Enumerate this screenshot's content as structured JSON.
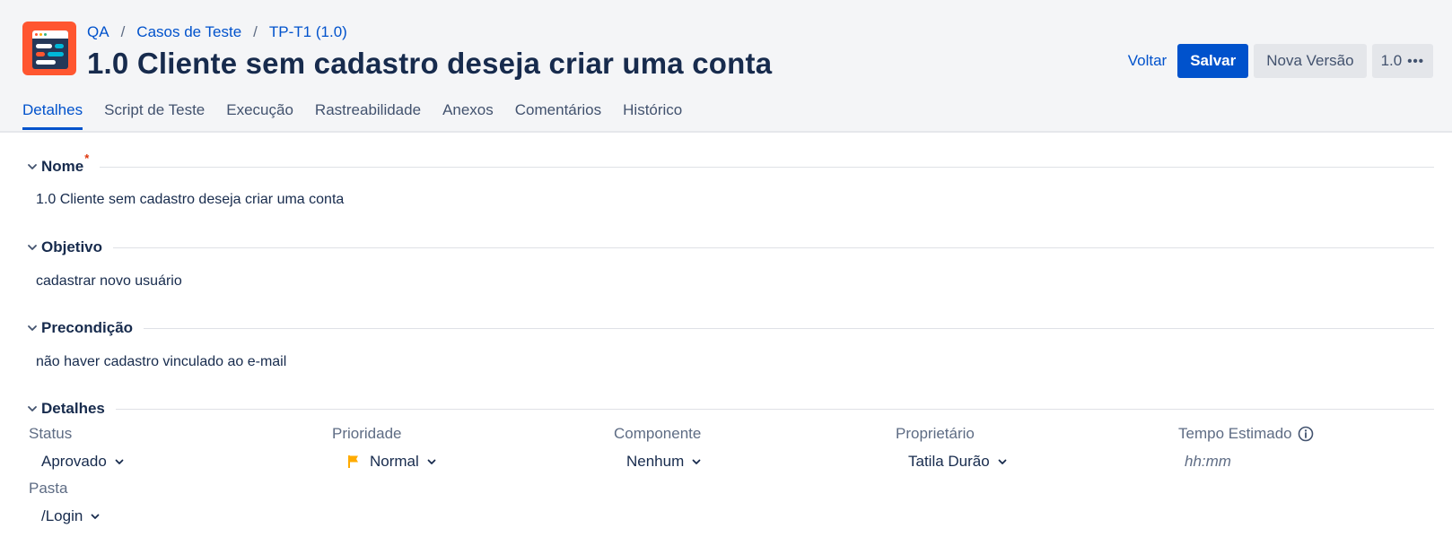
{
  "breadcrumb": {
    "items": [
      "QA",
      "Casos de Teste",
      "TP-T1 (1.0)"
    ],
    "separator": "/"
  },
  "page_title": "1.0 Cliente sem cadastro deseja criar uma conta",
  "actions": {
    "back_label": "Voltar",
    "save_label": "Salvar",
    "new_version_label": "Nova Versão",
    "version_label": "1.0"
  },
  "tabs": [
    {
      "label": "Detalhes",
      "active": true
    },
    {
      "label": "Script de Teste",
      "active": false
    },
    {
      "label": "Execução",
      "active": false
    },
    {
      "label": "Rastreabilidade",
      "active": false
    },
    {
      "label": "Anexos",
      "active": false
    },
    {
      "label": "Comentários",
      "active": false
    },
    {
      "label": "Histórico",
      "active": false
    }
  ],
  "sections": {
    "nome": {
      "title": "Nome",
      "required_mark": "*",
      "value": "1.0 Cliente sem cadastro deseja criar uma conta"
    },
    "objetivo": {
      "title": "Objetivo",
      "value": "cadastrar novo usuário"
    },
    "precondicao": {
      "title": "Precondição",
      "value": "não haver cadastro vinculado ao e-mail"
    },
    "detalhes": {
      "title": "Detalhes"
    }
  },
  "fields": {
    "status": {
      "label": "Status",
      "value": "Aprovado"
    },
    "prioridade": {
      "label": "Prioridade",
      "value": "Normal"
    },
    "componente": {
      "label": "Componente",
      "value": "Nenhum"
    },
    "proprietario": {
      "label": "Proprietário",
      "value": "Tatila Durão"
    },
    "tempo_estimado": {
      "label": "Tempo Estimado",
      "placeholder": "hh:mm"
    },
    "pasta": {
      "label": "Pasta",
      "value": "/Login"
    }
  },
  "colors": {
    "accent": "#0052cc",
    "logo_bg": "#ff5630",
    "priority_flag": "#ffab00",
    "required": "#de350b"
  },
  "icons": {
    "logo": "test-case-app-logo",
    "section_toggle": "chevron-down-icon",
    "dropdown": "chevron-down-icon",
    "info": "info-icon",
    "priority": "flag-icon",
    "more": "more-dots-icon"
  }
}
